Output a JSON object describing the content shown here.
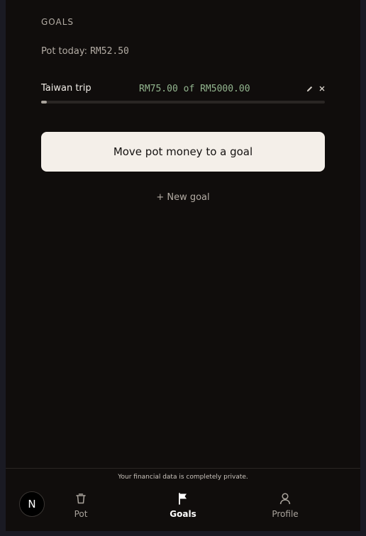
{
  "goals_section": {
    "heading": "GOALS",
    "pot_today_label": "Pot today: ",
    "pot_today_amount": "RM52.50"
  },
  "goals": [
    {
      "name": "Taiwan trip",
      "progress_text": "RM75.00 of RM5000.00",
      "saved": 75.0,
      "target": 5000.0,
      "progress_fraction": 0.015,
      "edit_icon": "pencil-icon",
      "delete_icon": "close-icon"
    }
  ],
  "actions": {
    "move_button_label": "Move pot money to a goal",
    "new_goal_label": "+ New goal"
  },
  "footer": {
    "privacy_note": "Your financial data is completely private.",
    "avatar_letter": "N"
  },
  "nav": {
    "items": [
      {
        "label": "Pot",
        "icon": "pot-icon",
        "active": false
      },
      {
        "label": "Goals",
        "icon": "flag-icon",
        "active": true
      },
      {
        "label": "Profile",
        "icon": "user-icon",
        "active": false
      }
    ]
  },
  "colors": {
    "background": "#100d0c",
    "accent_green": "#93b68f",
    "button_bg": "#f4efe9"
  }
}
